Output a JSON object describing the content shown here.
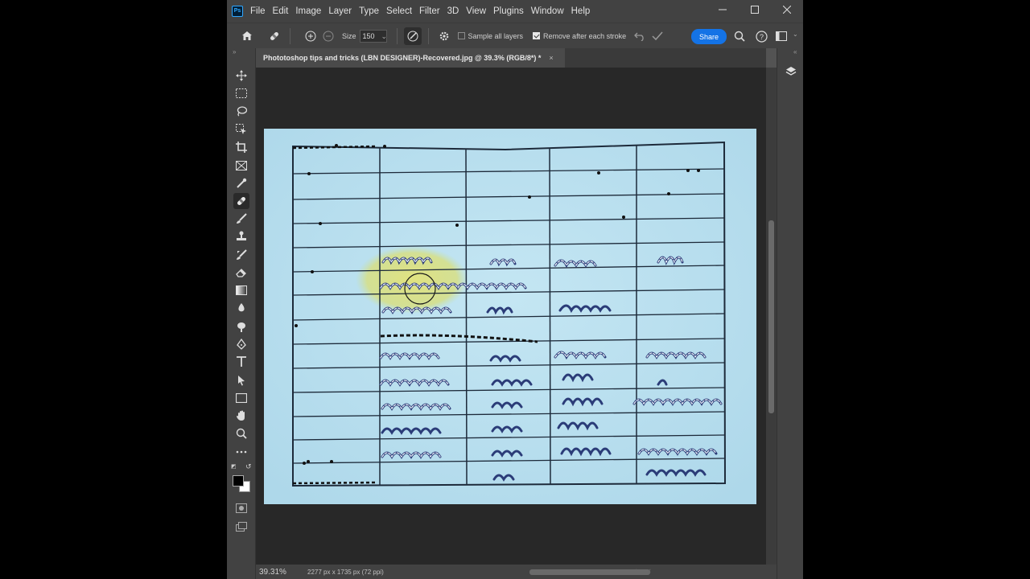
{
  "app": {
    "logo_text": "Ps",
    "menu": [
      "File",
      "Edit",
      "Image",
      "Layer",
      "Type",
      "Select",
      "Filter",
      "3D",
      "View",
      "Plugins",
      "Window",
      "Help"
    ],
    "window_controls": [
      "minimize-icon",
      "maximize-icon",
      "close-icon"
    ]
  },
  "options": {
    "size_label": "Size",
    "size_value": "150",
    "sample_all_layers_label": "Sample all layers",
    "sample_all_layers_checked": false,
    "remove_after_stroke_label": "Remove after each stroke",
    "remove_after_stroke_checked": true,
    "share_label": "Share"
  },
  "document": {
    "tab_title": "Phototoshop tips and tricks (LBN DESIGNER)-Recovered.jpg @ 39.3% (RGB/8*) *",
    "tab_close": "×"
  },
  "tools": [
    "move-icon",
    "marquee-icon",
    "lasso-icon",
    "object-select-icon",
    "crop-icon",
    "frame-icon",
    "eyedropper-icon",
    "healing-brush-icon",
    "brush-icon",
    "clone-stamp-icon",
    "history-brush-icon",
    "eraser-icon",
    "gradient-icon",
    "blur-icon",
    "dodge-icon",
    "pen-icon",
    "type-icon",
    "path-select-icon",
    "rectangle-icon",
    "hand-icon",
    "zoom-icon",
    "more-tools-icon"
  ],
  "colors": {
    "foreground": "#000000",
    "background": "#ffffff",
    "accent": "#1473e6",
    "paper": "#b9e0ef",
    "ink": "#2a3a6a"
  },
  "status": {
    "zoom": "39.31%",
    "dimensions": "2277 px x 1735 px (72 ppi)"
  }
}
